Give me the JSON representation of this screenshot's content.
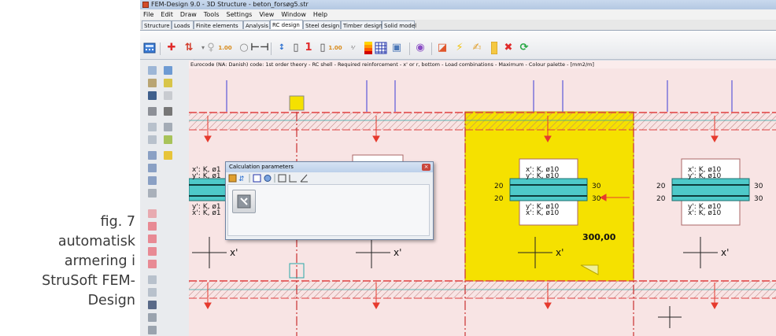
{
  "caption": {
    "lines": [
      "fig. 7",
      "automatisk",
      "armering i",
      "StruSoft FEM-",
      "Design"
    ]
  },
  "window": {
    "title": "FEM-Design 9.0 - 3D Structure - beton_forsøg5.str"
  },
  "menu": [
    "File",
    "Edit",
    "Draw",
    "Tools",
    "Settings",
    "View",
    "Window",
    "Help"
  ],
  "tabs": [
    {
      "label": "Structure",
      "active": false
    },
    {
      "label": "Loads",
      "active": false
    },
    {
      "label": "Finite elements",
      "active": false
    },
    {
      "label": "Analysis",
      "active": false
    },
    {
      "label": "RC design",
      "active": true
    },
    {
      "label": "Steel design",
      "active": false
    },
    {
      "label": "Timber design",
      "active": false
    },
    {
      "label": "Solid model",
      "active": false
    }
  ],
  "info_text": "Eurocode (NA: Danish) code: 1st order theory - RC shell - Required reinforcement - x' or r, bottom - Load combinations - Maximum - Colour palette - [mm2/m]",
  "dialog": {
    "title": "Calculation parameters",
    "close_glyph": "×"
  },
  "labels": {
    "xk": "x': K, ø10",
    "yk": "y': K, ø10",
    "xk_trunc": "x': K, ø1",
    "yk_trunc": "y': K, ø1",
    "n20": "20",
    "n30": "30",
    "axis_x": "x'",
    "value": "300,00"
  },
  "colors": {
    "highlight": "#f5e100",
    "panel": "#f8e4e4",
    "beam_fill": "#4ec9c9",
    "wall_line": "#e04040",
    "load_arrow": "#e63a2e",
    "blue_line": "#3b3bd6"
  },
  "toolbar_icons": [
    "calculator-icon",
    "add-icon",
    "arrows-icon",
    "bulb-icon",
    "number-icon",
    "zoom-icon",
    "dimension-icon",
    "sort-icon",
    "ruler-icon",
    "one-icon",
    "number-icon",
    "fraction-icon",
    "palette-icon",
    "grid-icon",
    "display-icon",
    "settings-icon",
    "layers-icon",
    "lightning-icon",
    "hand-icon",
    "ruler-icon",
    "delete-icon",
    "refresh-icon"
  ]
}
